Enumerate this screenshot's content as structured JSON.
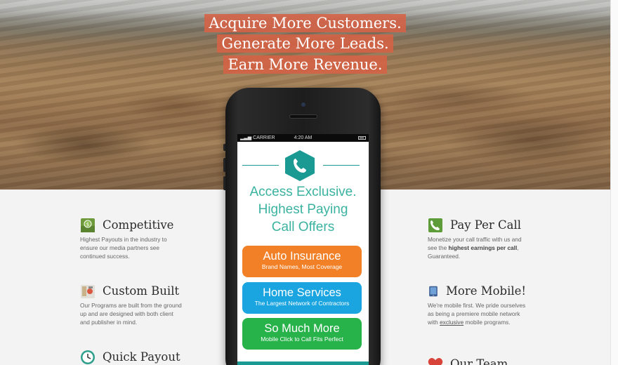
{
  "hero": {
    "headline_lines": [
      "Acquire More Customers.",
      "Generate More Leads.",
      "Earn More Revenue."
    ],
    "accent": "#d66245"
  },
  "phone": {
    "status": {
      "carrier": "CARRIER",
      "time": "4:20 AM"
    },
    "icon": "phone-icon",
    "tagline_lines": [
      "Access Exclusive.",
      "Highest Paying",
      "Call Offers"
    ],
    "offers": [
      {
        "title": "Auto Insurance",
        "subtitle": "Brand Names, Most Coverage",
        "color": "#f28027"
      },
      {
        "title": "Home Services",
        "subtitle": "The Largest Network of Contractors",
        "color": "#1aa5e1"
      },
      {
        "title": "So Much More",
        "subtitle": "Mobile Click to Call Fits Perfect",
        "color": "#27b24a"
      }
    ],
    "brand_color": "#1a9a92"
  },
  "features": {
    "left": [
      {
        "title": "Competitive",
        "icon": "money-icon",
        "text": "Highest Payouts in the industry to ensure our media partners see continued success."
      },
      {
        "title": "Custom Built",
        "icon": "tools-icon",
        "text": "Our Programs are built from the ground up and are designed with both client and publisher in mind."
      },
      {
        "title": "Quick Payout",
        "icon": "clock-icon",
        "text": ""
      }
    ],
    "right": [
      {
        "title": "Pay Per Call",
        "icon": "phone-call-icon",
        "text_before": "Monetize your call traffic with us and see the ",
        "text_bold": "highest earnings per call",
        "text_after": ", Guaranteed."
      },
      {
        "title": "More Mobile!",
        "icon": "mobile-icon",
        "text_before": "We're mobile first. We pride ourselves as being a premiere mobile network with ",
        "text_underline": "exclusive",
        "text_after": " mobile programs."
      },
      {
        "title": "Our Team",
        "icon": "heart-icon"
      }
    ]
  }
}
